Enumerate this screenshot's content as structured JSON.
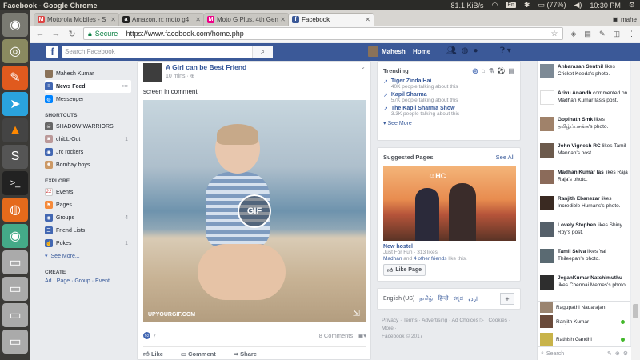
{
  "os": {
    "window_title": "Facebook - Google Chrome",
    "net_speed": "81.1 KiB/s",
    "keyboard": "En",
    "battery": "(77%)",
    "volume": "◀)",
    "time": "10:30 PM"
  },
  "launcher": [
    "ubuntu-icon",
    "rhythmbox-icon",
    "screenshot-icon",
    "telegram-icon",
    "vlc-icon",
    "sublime-icon",
    "terminal-icon",
    "firefox-icon",
    "chrome-icon",
    "drive-icon",
    "drive-icon",
    "drive-icon",
    "drive-icon",
    "trash-icon"
  ],
  "tabs": [
    {
      "label": "Motorola Mobiles - S",
      "fav": "M",
      "color": "#d44"
    },
    {
      "label": "Amazon.in: moto g4",
      "fav": "a",
      "color": "#222"
    },
    {
      "label": "Moto G Plus, 4th Gen",
      "fav": "M",
      "color": "#e08"
    },
    {
      "label": "Facebook",
      "fav": "f",
      "color": "#3b5998"
    }
  ],
  "profile_name": "mahe",
  "url": {
    "secure_label": "Secure",
    "address": "https://www.facebook.com/home.php"
  },
  "fb": {
    "search_placeholder": "Search Facebook",
    "user_name": "Mahesh",
    "home_label": "Home"
  },
  "leftnav": {
    "profile": "Mahesh Kumar",
    "news_feed": "News Feed",
    "messenger": "Messenger",
    "shortcuts_head": "SHORTCUTS",
    "shortcuts": [
      {
        "label": "SHADOW WARRIORS",
        "count": ""
      },
      {
        "label": "chiLL-Out",
        "count": "1"
      },
      {
        "label": "Jrc rockers",
        "count": ""
      },
      {
        "label": "Bombay boys",
        "count": ""
      }
    ],
    "explore_head": "EXPLORE",
    "explore": [
      {
        "label": "Events",
        "count": ""
      },
      {
        "label": "Pages",
        "count": ""
      },
      {
        "label": "Groups",
        "count": "4"
      },
      {
        "label": "Friend Lists",
        "count": ""
      },
      {
        "label": "Pokes",
        "count": "1"
      }
    ],
    "see_more": "See More...",
    "create_head": "CREATE",
    "create_links": "Ad · Page · Group · Event"
  },
  "post": {
    "title": "A Girl can be Best Friend",
    "time": "10 mins ·",
    "text": "screen in comment",
    "gif_label": "GIF",
    "gif_source": "UPYOURGIF.COM",
    "likes": "7",
    "comments": "8 Comments",
    "like_label": "Like",
    "comment_label": "Comment",
    "share_label": "Share"
  },
  "trending": {
    "title": "Trending",
    "items": [
      {
        "name": "Tiger Zinda Hai",
        "sub": "40K people talking about this"
      },
      {
        "name": "Kapil Sharma",
        "sub": "57K people talking about this"
      },
      {
        "name": "The Kapil Sharma Show",
        "sub": "3.3K people talking about this"
      }
    ],
    "see_more": "See More"
  },
  "suggested": {
    "title": "Suggested Pages",
    "see_all": "See All",
    "page_name": "New hostel",
    "page_sub": "Just For Fun · 313 likes",
    "friend": "Madhan",
    "and": " and ",
    "others": "4 other friends",
    "likes_this": " like this.",
    "like_page": "Like Page"
  },
  "lang": {
    "current": "English (US)",
    "others": [
      "தமிழ்",
      "हिन्दी",
      "ಕನ್ನಡ",
      "اردو"
    ],
    "plus": "+"
  },
  "footer": {
    "links": "Privacy · Terms · Advertising · Ad Choices ▷ · Cookies · More ·",
    "copyright": "Facebook © 2017"
  },
  "ticker": [
    {
      "name": "Anbarasan Senthil",
      "action": " likes Cricket Keeda's photo."
    },
    {
      "name": "Arivu Anandh",
      "action": " commented on Madhan Kumar Ias's post."
    },
    {
      "name": "Gopinath Smk",
      "action": " likes தமிழ்ப்பசங்க's photo."
    },
    {
      "name": "John Vignesh RC",
      "action": " likes Tamil Mannan's post."
    },
    {
      "name": "Madhan Kumar Ias",
      "action": " likes Raja Raja's photo."
    },
    {
      "name": "Ranjith Ebanezar",
      "action": " likes Incredible Humans's photo."
    },
    {
      "name": "Lovely Stephen",
      "action": " likes Shiny Roy's post."
    },
    {
      "name": "Tamil Selva",
      "action": " likes Yal Thileepan's photo."
    },
    {
      "name": "JeganKumar Natchimuthu",
      "action": " likes Chennai Memes's photo."
    }
  ],
  "chat": [
    {
      "name": "Ragupathi Nadarajan"
    },
    {
      "name": "Ranjith Kumar"
    },
    {
      "name": "Rathish Gandhi"
    }
  ],
  "chat_search": "Search"
}
